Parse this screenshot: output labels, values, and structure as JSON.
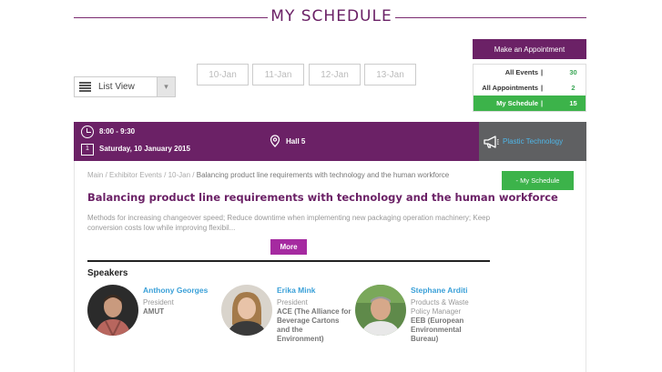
{
  "header": {
    "title": "MY SCHEDULE"
  },
  "sidebar": {
    "make_appointment": "Make an Appointment",
    "filters": [
      {
        "label": "All Events",
        "sep": "|",
        "count": "30"
      },
      {
        "label": "All Appointments",
        "sep": "|",
        "count": "2"
      },
      {
        "label": "My Schedule",
        "sep": "|",
        "count": "15"
      }
    ]
  },
  "view": {
    "selected": "List View",
    "icon": "list-icon"
  },
  "date_tabs": [
    "10-Jan",
    "11-Jan",
    "12-Jan",
    "13-Jan"
  ],
  "event": {
    "time": "8:00 - 9:30",
    "date": "Saturday, 10 January 2015",
    "calendar_day": "1",
    "hall": "Hall 5",
    "category": "Plastic Technology",
    "colors": {
      "primary": "#6b2166",
      "accent": "#3cb34a",
      "link": "#3aa0d8"
    }
  },
  "session": {
    "breadcrumb": {
      "items": [
        "Main",
        "Exhibitor Events",
        "10-Jan"
      ],
      "separator": "/",
      "current": "Balancing product line requirements with technology and the human workforce"
    },
    "my_schedule_button": "- My Schedule",
    "title": "Balancing product line requirements with technology and the human workforce",
    "description": "Methods for increasing changeover speed; Reduce downtime when implementing new packaging operation machinery; Keep conversion costs low while improving flexibil...",
    "more_button": "More",
    "speakers_heading": "Speakers",
    "speakers": [
      {
        "name": "Anthony Georges",
        "role": "President",
        "org": "AMUT"
      },
      {
        "name": "Erika Mink",
        "role": "President",
        "org": "ACE (The Alliance for Beverage Cartons and the Environment)"
      },
      {
        "name": "Stephane Arditi",
        "role": "Products & Waste Policy Manager",
        "org": "EEB (European Environmental Bureau)"
      }
    ]
  }
}
